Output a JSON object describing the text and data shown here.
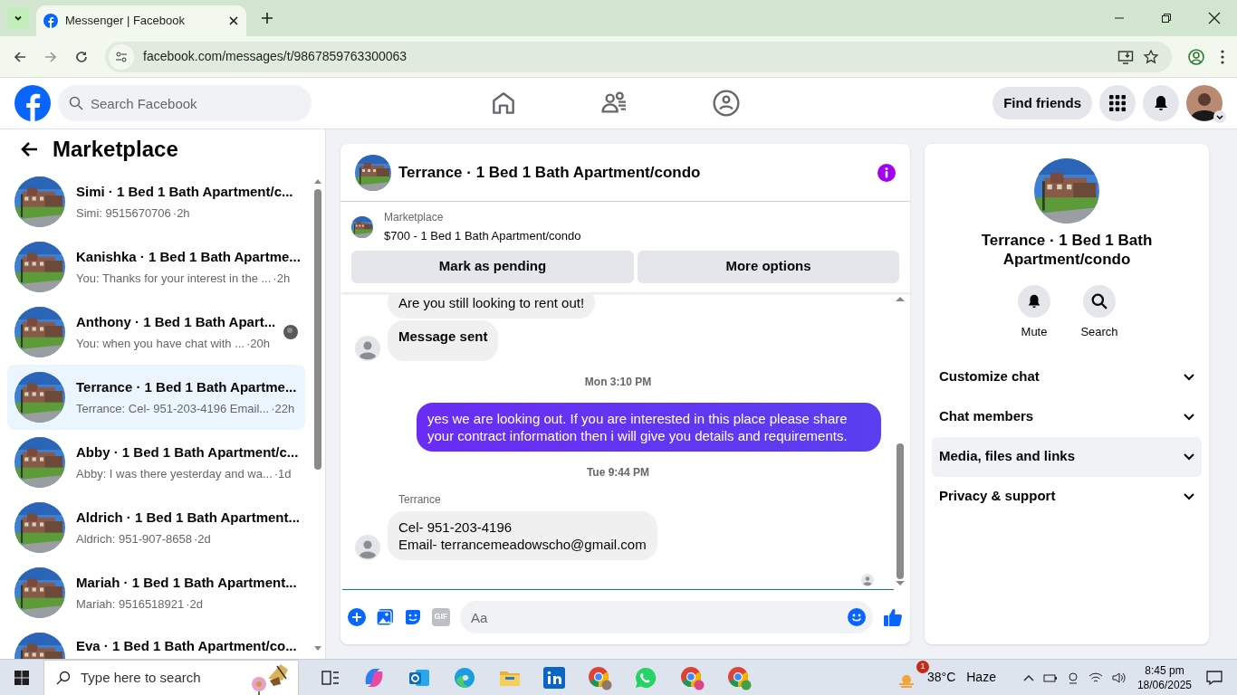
{
  "browser": {
    "tab_title": "Messenger | Facebook",
    "url": "facebook.com/messages/t/9867859763300063"
  },
  "header": {
    "search_placeholder": "Search Facebook",
    "find_friends": "Find friends"
  },
  "sidebar": {
    "title": "Marketplace",
    "conversations": [
      {
        "name": "Simi · 1 Bed 1 Bath Apartment/c...",
        "preview": "Simi: 9515670706",
        "time": "·2h",
        "selected": false,
        "read_receipt": false
      },
      {
        "name": "Kanishka · 1 Bed 1 Bath Apartme...",
        "preview": "You: Thanks for your interest in the ...",
        "time": "·2h",
        "selected": false,
        "read_receipt": false
      },
      {
        "name": "Anthony · 1 Bed 1 Bath Apart...",
        "preview": "You: when you have chat with ...",
        "time": "·20h",
        "selected": false,
        "read_receipt": true
      },
      {
        "name": "Terrance · 1 Bed 1 Bath Apartme...",
        "preview": "Terrance: Cel- 951-203-4196 Email...",
        "time": "·22h",
        "selected": true,
        "read_receipt": false
      },
      {
        "name": "Abby · 1 Bed 1 Bath Apartment/c...",
        "preview": "Abby: I was there yesterday and wa...",
        "time": "·1d",
        "selected": false,
        "read_receipt": false
      },
      {
        "name": "Aldrich · 1 Bed 1 Bath Apartment...",
        "preview": "Aldrich: 951-907-8658",
        "time": "·2d",
        "selected": false,
        "read_receipt": false
      },
      {
        "name": "Mariah · 1 Bed 1 Bath Apartment...",
        "preview": "Mariah: 9516518921",
        "time": "·2d",
        "selected": false,
        "read_receipt": false
      },
      {
        "name": "Eva · 1 Bed 1 Bath Apartment/co...",
        "selected": false,
        "read_receipt": false
      }
    ]
  },
  "chat": {
    "title": "Terrance · 1 Bed 1 Bath Apartment/condo",
    "listing": {
      "label": "Marketplace",
      "title": "$700 - 1 Bed 1 Bath Apartment/condo"
    },
    "actions": [
      "Mark as pending",
      "More options"
    ],
    "messages": [
      {
        "kind": "incoming",
        "text": "Are you still looking to rent out!",
        "bold": false,
        "avatar": false
      },
      {
        "kind": "incoming",
        "text": "Message sent",
        "bold": true,
        "avatar": true
      },
      {
        "kind": "time",
        "text": "Mon 3:10 PM"
      },
      {
        "kind": "outgoing",
        "text": "yes we are looking out. If you are interested in this place please share your contract information then i will give you details and requirements."
      },
      {
        "kind": "time",
        "text": "Tue 9:44 PM"
      },
      {
        "kind": "incoming",
        "sender": "Terrance",
        "text": "Cel- 951-203-4196\nEmail- terrancemeadowscho@gmail.com",
        "bold": false,
        "avatar": true
      }
    ],
    "composer": {
      "placeholder": "Aa",
      "gif": "GIF"
    }
  },
  "details": {
    "title": "Terrance · 1 Bed 1 Bath Apartment/condo",
    "actions": [
      {
        "kind": "mute",
        "label": "Mute"
      },
      {
        "kind": "search",
        "label": "Search"
      }
    ],
    "sections": [
      {
        "label": "Customize chat",
        "selected": false
      },
      {
        "label": "Chat members",
        "selected": false
      },
      {
        "label": "Media, files and links",
        "selected": true
      },
      {
        "label": "Privacy & support",
        "selected": false
      }
    ]
  },
  "taskbar": {
    "search_placeholder": "Type here to search",
    "weather_badge": "1",
    "temperature": "38°C",
    "weather": "Haze",
    "time": "8:45 pm",
    "date": "18/06/2025"
  }
}
